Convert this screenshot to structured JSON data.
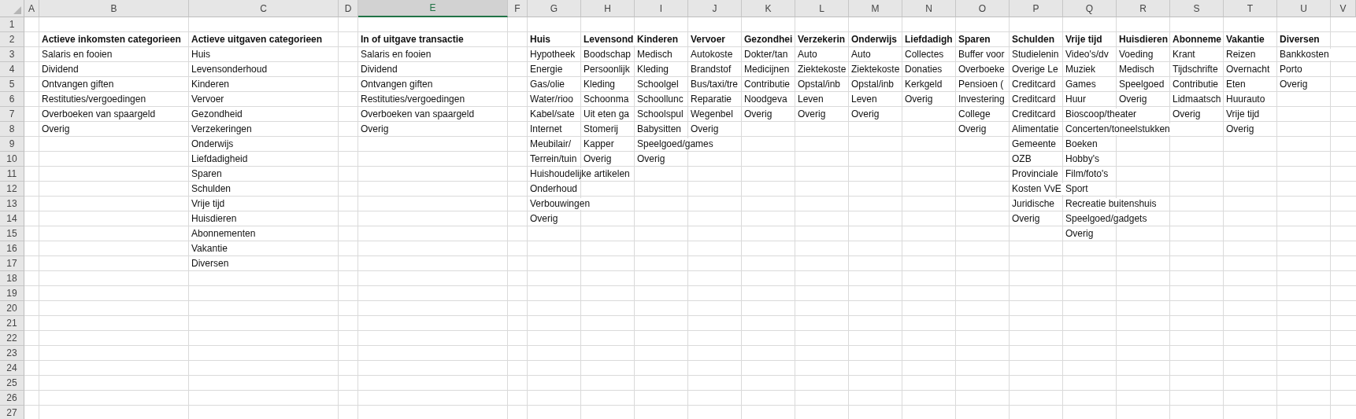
{
  "row_headers": [
    "1",
    "2",
    "3",
    "4",
    "5",
    "6",
    "7",
    "8",
    "9",
    "10",
    "11",
    "12",
    "13",
    "14",
    "15",
    "16",
    "17",
    "18",
    "19",
    "20",
    "21",
    "22",
    "23",
    "24",
    "25",
    "26",
    "27"
  ],
  "columns": [
    {
      "header": "A",
      "selected": false
    },
    {
      "header": "B",
      "selected": false,
      "heading": "Actieve inkomsten categorieen",
      "items": [
        "Salaris en fooien",
        "Dividend",
        "Ontvangen giften",
        "Restituties/vergoedingen",
        "Overboeken van spaargeld",
        "Overig"
      ]
    },
    {
      "header": "C",
      "selected": false,
      "heading": "Actieve uitgaven categorieen",
      "items": [
        "Huis",
        "Levensonderhoud",
        "Kinderen",
        "Vervoer",
        "Gezondheid",
        "Verzekeringen",
        "Onderwijs",
        "Liefdadigheid",
        "Sparen",
        "Schulden",
        "Vrije tijd",
        "Huisdieren",
        "Abonnementen",
        "Vakantie",
        "Diversen"
      ]
    },
    {
      "header": "D",
      "selected": false
    },
    {
      "header": "E",
      "selected": true,
      "heading": "In of uitgave transactie",
      "items": [
        "Salaris en fooien",
        "Dividend",
        "Ontvangen giften",
        "Restituties/vergoedingen",
        "Overboeken van spaargeld",
        "Overig"
      ]
    },
    {
      "header": "F",
      "selected": false
    },
    {
      "header": "G",
      "selected": false,
      "heading": "Huis",
      "items": [
        "Hypotheek",
        "Energie",
        "Gas/olie",
        "Water/rioo",
        "Kabel/sate",
        "Internet",
        "Meubilair/",
        "Terrein/tuin",
        "Huishoudelijke artikelen",
        "Onderhoud",
        "Verbouwingen",
        "Overig"
      ]
    },
    {
      "header": "H",
      "selected": false,
      "heading": "Levensond",
      "items": [
        "Boodschap",
        "Persoonlijk",
        "Kleding",
        "Schoonma",
        "Uit eten ga",
        "Stomerij",
        "Kapper",
        "Overig"
      ]
    },
    {
      "header": "I",
      "selected": false,
      "heading": "Kinderen",
      "items": [
        "Medisch",
        "Kleding",
        "Schoolgel",
        "Schoollunc",
        "Schoolspul",
        "Babysitten",
        "Speelgoed/games",
        "Overig"
      ]
    },
    {
      "header": "J",
      "selected": false,
      "heading": "Vervoer",
      "items": [
        "Autokoste",
        "Brandstof",
        "Bus/taxi/tre",
        "Reparatie",
        "Wegenbel",
        "Overig"
      ]
    },
    {
      "header": "K",
      "selected": false,
      "heading": "Gezondhei",
      "items": [
        "Dokter/tan",
        "Medicijnen",
        "Contributie",
        "Noodgeva",
        "Overig"
      ]
    },
    {
      "header": "L",
      "selected": false,
      "heading": "Verzekerin",
      "items": [
        "Auto",
        "Ziektekoste",
        "Opstal/inb",
        "Leven",
        "Overig"
      ]
    },
    {
      "header": "M",
      "selected": false,
      "heading": "Onderwijs",
      "items": [
        "Auto",
        "Ziektekoste",
        "Opstal/inb",
        "Leven",
        "Overig"
      ]
    },
    {
      "header": "N",
      "selected": false,
      "heading": "Liefdadigh",
      "items": [
        "Collectes",
        "Donaties",
        "Kerkgeld",
        "Overig"
      ]
    },
    {
      "header": "O",
      "selected": false,
      "heading": "Sparen",
      "items": [
        "Buffer voor",
        "Overboeke",
        "Pensioen (",
        "Investering",
        "College",
        "Overig"
      ]
    },
    {
      "header": "P",
      "selected": false,
      "heading": "Schulden",
      "items": [
        "Studielenin",
        "Overige Le",
        "Creditcard",
        "Creditcard",
        "Creditcard",
        "Alimentatie",
        "Gemeente",
        "OZB",
        "Provinciale",
        "Kosten VvE",
        "Juridische",
        "Overig"
      ]
    },
    {
      "header": "Q",
      "selected": false,
      "heading": "Vrije tijd",
      "items": [
        "Video's/dv",
        "Muziek",
        "Games",
        "Huur",
        "Bioscoop/theater",
        "Concerten/toneelstukken",
        "Boeken",
        "Hobby's",
        "Film/foto's",
        "Sport",
        "Recreatie buitenshuis",
        "Speelgoed/gadgets",
        "Overig"
      ]
    },
    {
      "header": "R",
      "selected": false,
      "heading": "Huisdieren",
      "items": [
        "Voeding",
        "Medisch",
        "Speelgoed",
        "Overig"
      ]
    },
    {
      "header": "S",
      "selected": false,
      "heading": "Abonneme",
      "items": [
        "Krant",
        "Tijdschrifte",
        "Contributie",
        "Lidmaatsch",
        "Overig"
      ]
    },
    {
      "header": "T",
      "selected": false,
      "heading": "Vakantie",
      "items": [
        "Reizen",
        "Overnacht",
        "Eten",
        "Huurauto",
        "Vrije tijd",
        "Overig"
      ]
    },
    {
      "header": "U",
      "selected": false,
      "heading": "Diversen",
      "items": [
        "Bankkosten",
        "Porto",
        "Overig"
      ]
    },
    {
      "header": "V",
      "selected": false
    }
  ]
}
